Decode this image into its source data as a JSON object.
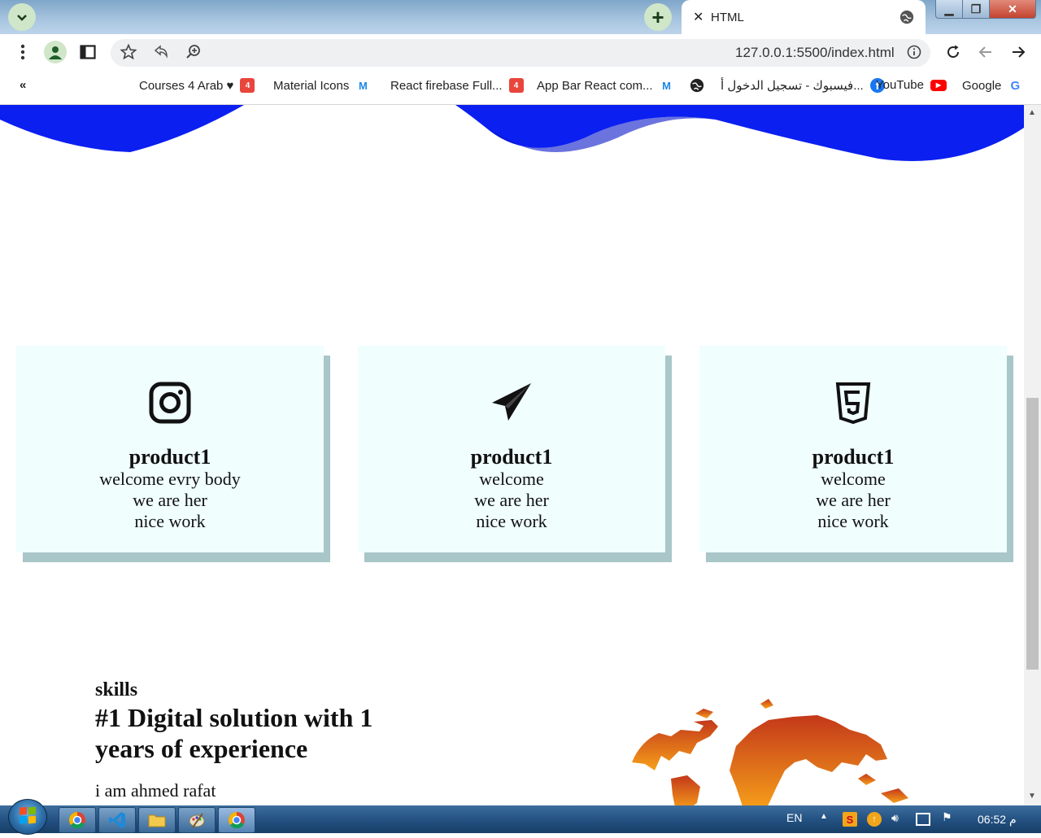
{
  "browser": {
    "tab_title": "HTML",
    "url": "127.0.0.1:5500/index.html",
    "bookmarks_overflow": "«",
    "bookmarks": [
      {
        "label": "Courses 4 Arab ♥"
      },
      {
        "label": "Material Icons"
      },
      {
        "label": "React firebase Full..."
      },
      {
        "label": "App Bar React com..."
      },
      {
        "label": "فيسبوك - تسجيل الدخول أ..."
      },
      {
        "label": "YouTube"
      },
      {
        "label": "Google"
      }
    ]
  },
  "page": {
    "cards": [
      {
        "icon": "instagram-icon",
        "title": "product1",
        "lines": [
          "welcome evry body",
          "we are her",
          "nice work"
        ]
      },
      {
        "icon": "paper-plane-icon",
        "title": "product1",
        "lines": [
          "welcome",
          "we are her",
          "nice work"
        ]
      },
      {
        "icon": "html5-icon",
        "title": "product1",
        "lines": [
          "welcome",
          "we are her",
          "nice work"
        ]
      }
    ],
    "skills": {
      "label": "skills",
      "heading": "#1 Digital solution with 1 years of experience",
      "text": "i am ahmed rafat"
    },
    "colors": {
      "wave": "#0b1ff0",
      "card_bg": "#f0fefe",
      "card_shadow": "#a9c6c8"
    }
  },
  "taskbar": {
    "language": "EN",
    "clock": "06:52 م"
  }
}
